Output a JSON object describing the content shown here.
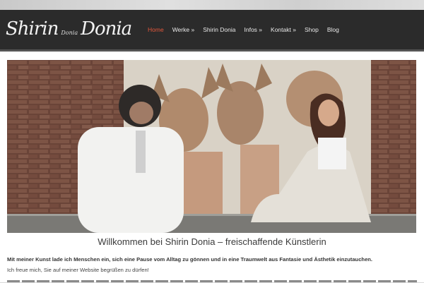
{
  "logo": {
    "word1": "Shirin",
    "mid": "Donia",
    "word2": "Donia"
  },
  "nav": {
    "items": [
      {
        "label": "Home",
        "active": true
      },
      {
        "label": "Werke »"
      },
      {
        "label": "Shirin Donia"
      },
      {
        "label": "Infos »"
      },
      {
        "label": "Kontakt »"
      },
      {
        "label": "Shop"
      },
      {
        "label": "Blog"
      }
    ]
  },
  "main": {
    "title": "Willkommen bei Shirin Donia – freischaffende Künstlerin",
    "intro_bold": "Mit meiner Kunst lade ich Menschen ein, sich eine Pause vom Alltag zu gönnen und in eine Traumwelt aus Fantasie und Ästhetik einzutauchen.",
    "intro_regular": "Ich freue mich, Sie auf meiner Website begrüßen zu dürfen!"
  },
  "colors": {
    "nav_bg": "#2b2b2b",
    "active": "#e2573b",
    "brick": "#6e4a3c"
  }
}
